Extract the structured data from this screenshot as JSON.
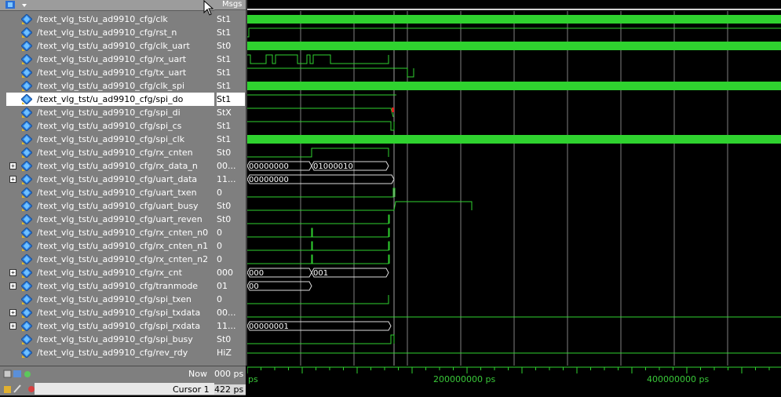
{
  "header": {
    "msgs_label": "Msgs"
  },
  "signals": [
    {
      "name": "/text_vlg_tst/u_ad9910_cfg/clk",
      "value": "St1",
      "expandable": false
    },
    {
      "name": "/text_vlg_tst/u_ad9910_cfg/rst_n",
      "value": "St1",
      "expandable": false
    },
    {
      "name": "/text_vlg_tst/u_ad9910_cfg/clk_uart",
      "value": "St0",
      "expandable": false
    },
    {
      "name": "/text_vlg_tst/u_ad9910_cfg/rx_uart",
      "value": "St1",
      "expandable": false
    },
    {
      "name": "/text_vlg_tst/u_ad9910_cfg/tx_uart",
      "value": "St1",
      "expandable": false
    },
    {
      "name": "/text_vlg_tst/u_ad9910_cfg/clk_spi",
      "value": "St1",
      "expandable": false
    },
    {
      "name": "/text_vlg_tst/u_ad9910_cfg/spi_do",
      "value": "St1",
      "expandable": false,
      "selected": true
    },
    {
      "name": "/text_vlg_tst/u_ad9910_cfg/spi_di",
      "value": "StX",
      "expandable": false
    },
    {
      "name": "/text_vlg_tst/u_ad9910_cfg/spi_cs",
      "value": "St1",
      "expandable": false
    },
    {
      "name": "/text_vlg_tst/u_ad9910_cfg/spi_clk",
      "value": "St1",
      "expandable": false
    },
    {
      "name": "/text_vlg_tst/u_ad9910_cfg/rx_cnten",
      "value": "St0",
      "expandable": false
    },
    {
      "name": "/text_vlg_tst/u_ad9910_cfg/rx_data_n",
      "value": "00...",
      "expandable": true
    },
    {
      "name": "/text_vlg_tst/u_ad9910_cfg/uart_data",
      "value": "11...",
      "expandable": true
    },
    {
      "name": "/text_vlg_tst/u_ad9910_cfg/uart_txen",
      "value": "0",
      "expandable": false
    },
    {
      "name": "/text_vlg_tst/u_ad9910_cfg/uart_busy",
      "value": "St0",
      "expandable": false
    },
    {
      "name": "/text_vlg_tst/u_ad9910_cfg/uart_reven",
      "value": "St0",
      "expandable": false
    },
    {
      "name": "/text_vlg_tst/u_ad9910_cfg/rx_cnten_n0",
      "value": "0",
      "expandable": false
    },
    {
      "name": "/text_vlg_tst/u_ad9910_cfg/rx_cnten_n1",
      "value": "0",
      "expandable": false
    },
    {
      "name": "/text_vlg_tst/u_ad9910_cfg/rx_cnten_n2",
      "value": "0",
      "expandable": false
    },
    {
      "name": "/text_vlg_tst/u_ad9910_cfg/rx_cnt",
      "value": "000",
      "expandable": true
    },
    {
      "name": "/text_vlg_tst/u_ad9910_cfg/tranmode",
      "value": "01",
      "expandable": true
    },
    {
      "name": "/text_vlg_tst/u_ad9910_cfg/spi_txen",
      "value": "0",
      "expandable": false
    },
    {
      "name": "/text_vlg_tst/u_ad9910_cfg/spi_txdata",
      "value": "00...",
      "expandable": true
    },
    {
      "name": "/text_vlg_tst/u_ad9910_cfg/spi_rxdata",
      "value": "11...",
      "expandable": true
    },
    {
      "name": "/text_vlg_tst/u_ad9910_cfg/spi_busy",
      "value": "St0",
      "expandable": false
    },
    {
      "name": "/text_vlg_tst/u_ad9910_cfg/rev_rdy",
      "value": "HiZ",
      "expandable": false
    }
  ],
  "bus_labels": {
    "rx_data_n_a": "00000000",
    "rx_data_n_b": "01000010",
    "uart_data": "00000000",
    "rx_cnt_a": "000",
    "rx_cnt_b": "001",
    "tranmode": "00",
    "spi_rxdata": "00000001"
  },
  "status": {
    "now_label": "Now",
    "now_value": "000 ps",
    "cursor_label": "Cursor 1",
    "cursor_value": "422 ps"
  },
  "time_axis": {
    "ticks": [
      "ps",
      "200000000 ps",
      "400000000 ps"
    ]
  },
  "colors": {
    "wave": "#2fd22f",
    "bus_label": "#ffffff",
    "grid": "#808080"
  }
}
